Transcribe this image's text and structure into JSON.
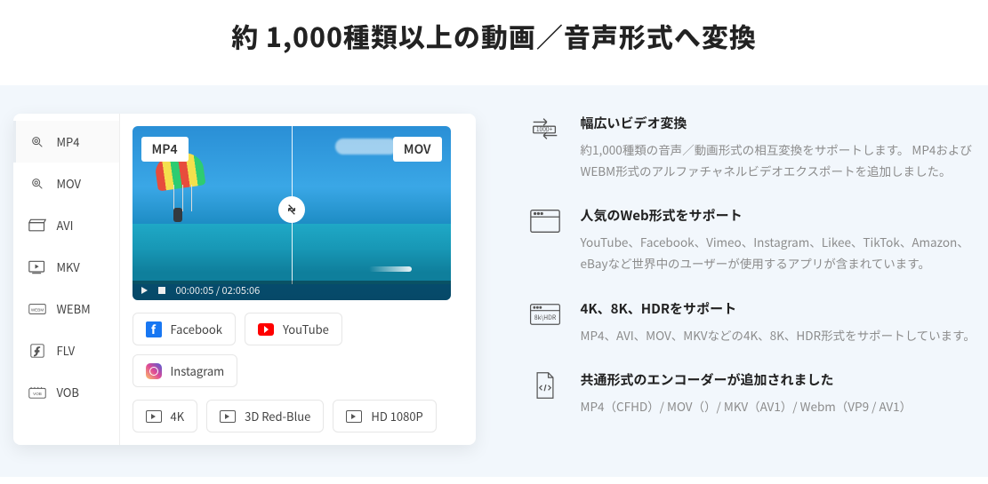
{
  "hero": {
    "title": "約 1,000種類以上の動画／音声形式へ変換"
  },
  "sidebar": {
    "items": [
      {
        "label": "MP4"
      },
      {
        "label": "MOV"
      },
      {
        "label": "AVI"
      },
      {
        "label": "MKV"
      },
      {
        "label": "WEBM"
      },
      {
        "label": "FLV"
      },
      {
        "label": "VOB"
      }
    ]
  },
  "preview": {
    "badge_left": "MP4",
    "badge_right": "MOV",
    "timecode": "00:00:05 / 02:05:06"
  },
  "chips": {
    "social": [
      {
        "label": "Facebook"
      },
      {
        "label": "YouTube"
      },
      {
        "label": "Instagram"
      }
    ],
    "quality": [
      {
        "label": "4K"
      },
      {
        "label": "3D Red-Blue"
      },
      {
        "label": "HD 1080P"
      }
    ]
  },
  "features": [
    {
      "title": "幅広いビデオ変換",
      "desc": "約1,000種類の音声／動画形式の相互変換をサポートします。 MP4およびWEBM形式のアルファチャネルビデオエクスポートを追加しました。"
    },
    {
      "title": "人気のWeb形式をサポート",
      "desc": "YouTube、Facebook、Vimeo、Instagram、Likee、TikTok、Amazon、eBayなど世界中のユーザーが使用するアプリが含まれています。"
    },
    {
      "title": "4K、8K、HDRをサポート",
      "desc": "MP4、AVI、MOV、MKVなどの4K、8K、HDR形式をサポートしています。"
    },
    {
      "title": "共通形式のエンコーダーが追加されました",
      "desc": "MP4（CFHD）/ MOV（）/ MKV（AV1）/ Webm（VP9 / AV1）"
    }
  ],
  "feature_icons": {
    "f2_label": "1000+",
    "f4_label": "8k\\HDR"
  }
}
